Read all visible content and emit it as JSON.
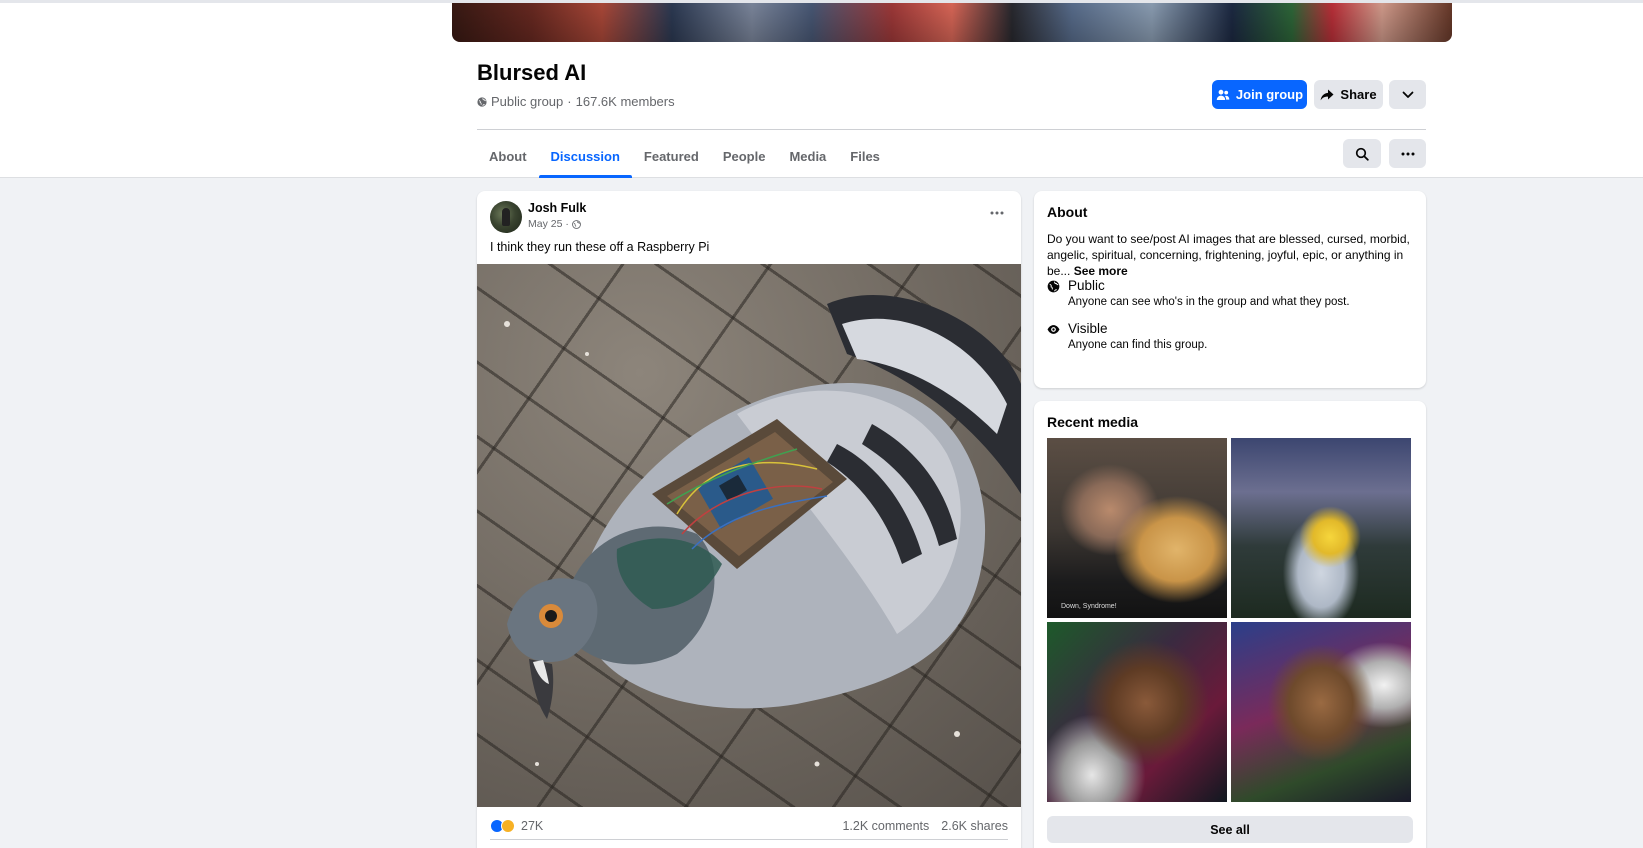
{
  "group": {
    "name": "Blursed AI",
    "privacy": "Public group",
    "separator": "·",
    "members": "167.6K members"
  },
  "actions": {
    "join_label": "Join group",
    "share_label": "Share"
  },
  "tabs": [
    {
      "label": "About",
      "active": false
    },
    {
      "label": "Discussion",
      "active": true
    },
    {
      "label": "Featured",
      "active": false
    },
    {
      "label": "People",
      "active": false
    },
    {
      "label": "Media",
      "active": false
    },
    {
      "label": "Files",
      "active": false
    }
  ],
  "post": {
    "author": "Josh Fulk",
    "time": "May 25 ·",
    "text": "I think they run these off a Raspberry Pi",
    "reaction_count": "27K",
    "comments": "1.2K comments",
    "shares": "2.6K shares"
  },
  "about": {
    "title": "About",
    "description": "Do you want to see/post AI images that are blessed, cursed, morbid, angelic, spiritual, concerning, frightening, joyful, epic, or anything in be...",
    "see_more": "See more",
    "public_title": "Public",
    "public_sub": "Anyone can see who's in the group and what they post.",
    "visible_title": "Visible",
    "visible_sub": "Anyone can find this group."
  },
  "recent_media": {
    "title": "Recent media",
    "thumb1_caption": "Down, Syndrome!",
    "see_all": "See all"
  },
  "colors": {
    "accent": "#0866ff",
    "secondary_button": "#e4e6eb",
    "page_bg": "#f0f2f5"
  },
  "icons": [
    "globe-icon",
    "join-people-icon",
    "share-arrow-icon",
    "chevron-down-icon",
    "search-icon",
    "more-dots-icon",
    "eye-icon",
    "like-reaction-icon",
    "haha-reaction-icon"
  ]
}
